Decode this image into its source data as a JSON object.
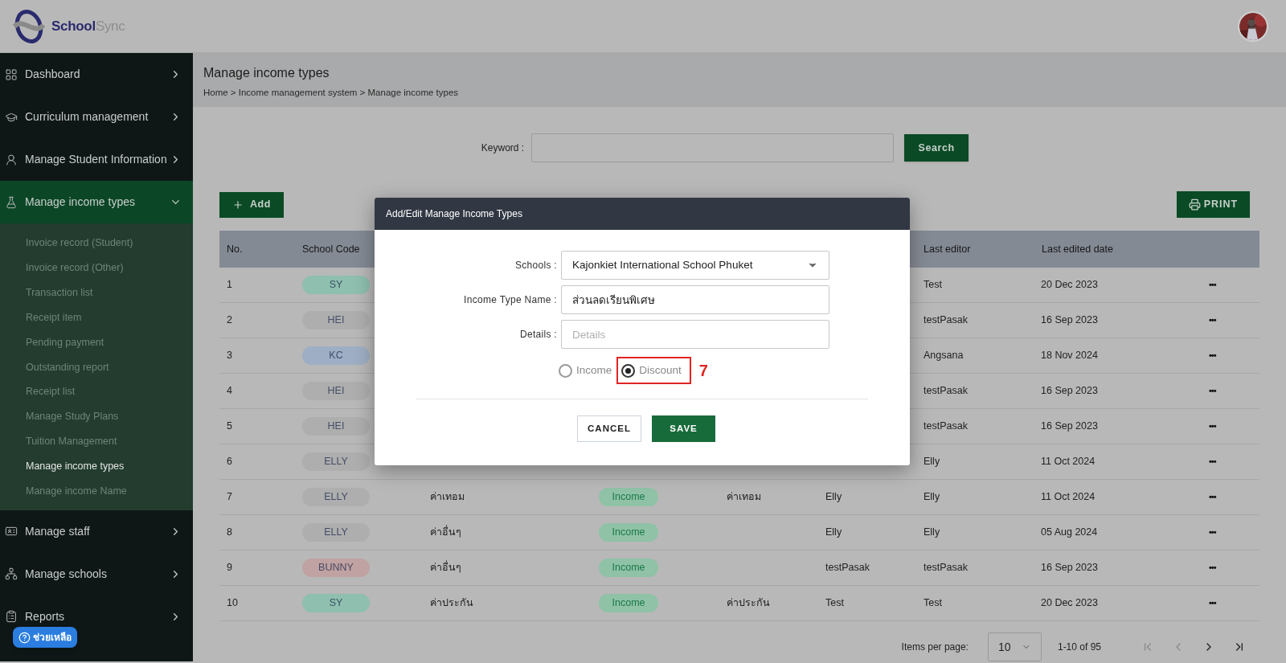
{
  "header": {
    "logo": {
      "part1": "School",
      "part2": "Sync"
    }
  },
  "sidebar": {
    "items": [
      {
        "label": "Dashboard",
        "expanded": false,
        "selected": false
      },
      {
        "label": "Curriculum management",
        "expanded": false,
        "selected": false
      },
      {
        "label": "Manage Student Information",
        "expanded": false,
        "selected": false
      },
      {
        "label": "Manage income types",
        "expanded": true,
        "selected": true,
        "children": [
          {
            "label": "Invoice record (Student)",
            "selected": false
          },
          {
            "label": "Invoice record (Other)",
            "selected": false
          },
          {
            "label": "Transaction list",
            "selected": false
          },
          {
            "label": "Receipt item",
            "selected": false
          },
          {
            "label": "Pending payment",
            "selected": false
          },
          {
            "label": "Outstanding report",
            "selected": false
          },
          {
            "label": "Receipt list",
            "selected": false
          },
          {
            "label": "Manage Study Plans",
            "selected": false
          },
          {
            "label": "Tuition Management",
            "selected": false
          },
          {
            "label": "Manage income types",
            "selected": true
          },
          {
            "label": "Manage income Name",
            "selected": false
          }
        ]
      },
      {
        "label": "Manage staff",
        "expanded": false,
        "selected": false
      },
      {
        "label": "Manage schools",
        "expanded": false,
        "selected": false
      },
      {
        "label": "Reports",
        "expanded": false,
        "selected": false
      }
    ],
    "help_button": "ช่วยเหลือ"
  },
  "page": {
    "title": "Manage income types",
    "breadcrumb": "Home > Income management system > Manage income types"
  },
  "search": {
    "label": "Keyword :",
    "button": "Search"
  },
  "toolbar": {
    "add_button": "Add",
    "print_button": "PRINT"
  },
  "table": {
    "columns": [
      "No.",
      "School Code",
      "",
      "",
      "",
      "",
      "Last editor",
      "Last edited date",
      ""
    ],
    "rows": [
      {
        "no": "1",
        "code": "SY",
        "color": "#8fbfae",
        "last_editor": "Test",
        "date": "20 Dec 2023",
        "menu": "•••"
      },
      {
        "no": "2",
        "code": "HEI",
        "color": "#aeaeae",
        "last_editor": "testPasak",
        "date": "16 Sep 2023",
        "menu": "•••"
      },
      {
        "no": "3",
        "code": "KC",
        "color": "#9eaec4",
        "last_editor": "Angsana",
        "date": "18 Nov 2024",
        "menu": "•••"
      },
      {
        "no": "4",
        "code": "HEI",
        "color": "#aeaeae",
        "last_editor": "testPasak",
        "date": "16 Sep 2023",
        "menu": "•••"
      },
      {
        "no": "5",
        "code": "HEI",
        "color": "#aeaeae",
        "last_editor": "testPasak",
        "date": "16 Sep 2023",
        "menu": "•••"
      },
      {
        "no": "6",
        "code": "ELLY",
        "color": "#aeaeae",
        "last_editor": "Elly",
        "date": "11 Oct 2024",
        "menu": "•••"
      },
      {
        "no": "7",
        "code": "ELLY",
        "color": "#aeaeae",
        "column_3": "ค่าเทอม",
        "column_4": "Income",
        "column_5": "ค่าเทอม",
        "column_6": "Elly",
        "last_editor": "Elly",
        "date": "11 Oct 2024",
        "menu": "•••"
      },
      {
        "no": "8",
        "code": "ELLY",
        "color": "#aeaeae",
        "column_3": "ค่าอื่นๆ",
        "column_4": "Income",
        "column_6": "Elly",
        "last_editor": "Elly",
        "date": "05 Aug 2024",
        "menu": "•••"
      },
      {
        "no": "9",
        "code": "BUNNY",
        "color": "#c0a2a2",
        "column_3": "ค่าอื่นๆ",
        "column_4": "Income",
        "column_6": "testPasak",
        "last_editor": "testPasak",
        "date": "16 Sep 2023",
        "menu": "•••"
      },
      {
        "no": "10",
        "code": "SY",
        "color": "#8fbfae",
        "column_3": "ค่าประกัน",
        "column_4": "Income",
        "column_5": "ค่าประกัน",
        "column_6": "Test",
        "last_editor": "Test",
        "date": "20 Dec 2023",
        "menu": "•••"
      }
    ]
  },
  "pagination": {
    "label": "Items per page:",
    "page_size": "10",
    "range": "1-10 of 95"
  },
  "dialog": {
    "title": "Add/Edit Manage Income Types",
    "fields": [
      {
        "kind": "select",
        "label": "Schools :",
        "value": "Kajonkiet International School Phuket"
      },
      {
        "kind": "text",
        "label": "Income Type Name :",
        "value": "ส่วนลดเรียนพิเศษ"
      },
      {
        "kind": "text",
        "label": "Details :",
        "placeholder": "Details"
      }
    ],
    "radios": [
      {
        "label": "Income",
        "selected": false
      },
      {
        "label": "Discount",
        "selected": true,
        "annotation": "7"
      }
    ],
    "cancel_button": "CANCEL",
    "save_button": "SAVE"
  }
}
